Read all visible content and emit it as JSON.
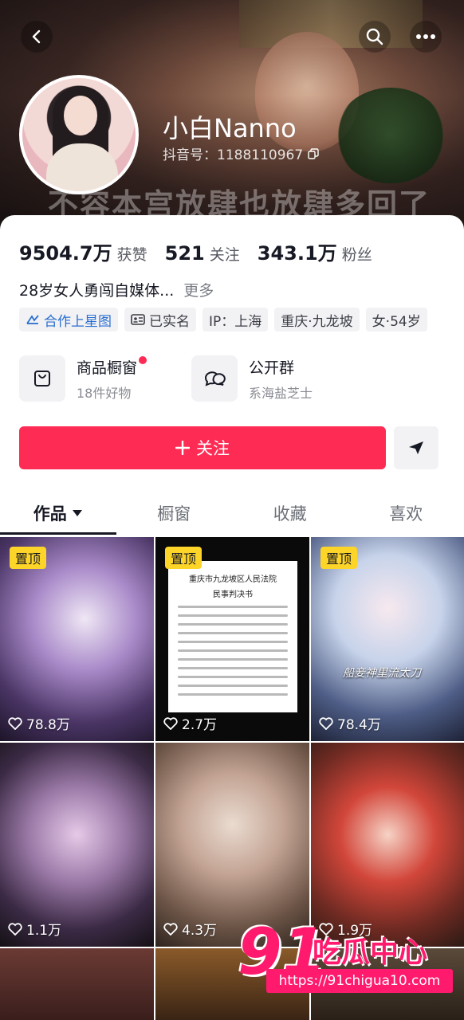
{
  "header": {
    "back_icon": "back-chevron-icon",
    "search_icon": "search-icon",
    "more_icon": "more-dots-icon",
    "video_subtitle": "不容本宫放肆也放肆多回了"
  },
  "profile": {
    "name": "小白Nanno",
    "douyin_id": "抖音号：1188110967",
    "copy_icon": "copy-icon"
  },
  "stats": [
    {
      "num": "9504.7万",
      "label": "获赞"
    },
    {
      "num": "521",
      "label": "关注"
    },
    {
      "num": "343.1万",
      "label": "粉丝"
    }
  ],
  "bio": {
    "text": "28岁女人勇闯自媒体...",
    "more": "更多"
  },
  "tags": [
    {
      "label": "合作上星图",
      "icon": "star-map-icon"
    },
    {
      "label": "已实名",
      "icon": "id-card-icon"
    },
    {
      "label": "IP：上海"
    },
    {
      "label": "重庆·九龙坡"
    },
    {
      "label": "女·54岁"
    }
  ],
  "cards": {
    "shop": {
      "title": "商品橱窗",
      "sub": "18件好物",
      "icon": "shopping-bag-icon"
    },
    "group": {
      "title": "公开群",
      "sub": "系海盐芝士",
      "icon": "chat-bubbles-icon"
    }
  },
  "actions": {
    "follow_label": "关注",
    "plus_icon": "plus-icon",
    "share_icon": "paper-plane-icon"
  },
  "tabs": [
    {
      "label": "作品",
      "active": true
    },
    {
      "label": "橱窗"
    },
    {
      "label": "收藏"
    },
    {
      "label": "喜欢"
    }
  ],
  "videos": [
    {
      "pinned": "置顶",
      "likes": "78.8万"
    },
    {
      "pinned": "置顶",
      "likes": "2.7万",
      "doc_title": "重庆市九龙坡区人民法院",
      "doc_sub": "民事判决书"
    },
    {
      "pinned": "置顶",
      "likes": "78.4万",
      "caption": "船妾神里流太刀"
    },
    {
      "likes": "1.1万"
    },
    {
      "likes": "4.3万"
    },
    {
      "likes": "1.9万"
    }
  ],
  "watermark": {
    "brand_number": "91",
    "brand_text": "吃瓜中心",
    "url": "https://91chigua10.com"
  },
  "colors": {
    "accent": "#fe2c55",
    "pin": "#fdd428",
    "blue_tag": "#2a6fd1",
    "watermark": "#ff1a6e"
  }
}
